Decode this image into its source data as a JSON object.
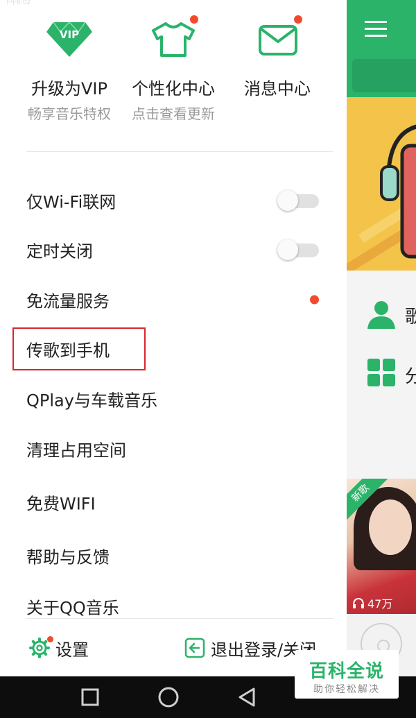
{
  "status_bar": {
    "time": "下午6:02"
  },
  "quick_actions": [
    {
      "title": "升级为VIP",
      "subtitle": "畅享音乐特权",
      "icon": "vip-diamond-icon",
      "badge": false
    },
    {
      "title": "个性化中心",
      "subtitle": "点击查看更新",
      "icon": "tshirt-icon",
      "badge": true
    },
    {
      "title": "消息中心",
      "subtitle": "",
      "icon": "envelope-icon",
      "badge": true
    }
  ],
  "menu": {
    "items": [
      {
        "label": "仅Wi-Fi联网",
        "control": "toggle",
        "on": false
      },
      {
        "label": "定时关闭",
        "control": "toggle",
        "on": false
      },
      {
        "label": "免流量服务",
        "control": "red-dot"
      },
      {
        "label": "传歌到手机",
        "control": "none",
        "highlighted": true
      },
      {
        "label": "QPlay与车载音乐",
        "control": "none"
      },
      {
        "label": "清理占用空间",
        "control": "none"
      },
      {
        "label": "免费WIFI",
        "control": "none"
      },
      {
        "label": "帮助与反馈",
        "control": "none"
      },
      {
        "label": "关于QQ音乐",
        "control": "none"
      }
    ]
  },
  "footer": {
    "settings_label": "设置",
    "logout_label": "退出登录/关闭",
    "settings_badge": true
  },
  "background_app": {
    "row1_label": "歌",
    "row2_label": "分",
    "album_badge": "新歌",
    "album_plays": "47万"
  },
  "nav_bar": {
    "buttons": [
      "square-icon",
      "circle-icon",
      "back-triangle-icon"
    ]
  },
  "watermark": {
    "title": "百科全说",
    "subtitle": "助你轻松解决"
  },
  "colors": {
    "accent": "#2bb36a",
    "badge_red": "#f04b2e",
    "highlight_box": "#d8262d",
    "subtext": "#9a9a9a"
  }
}
